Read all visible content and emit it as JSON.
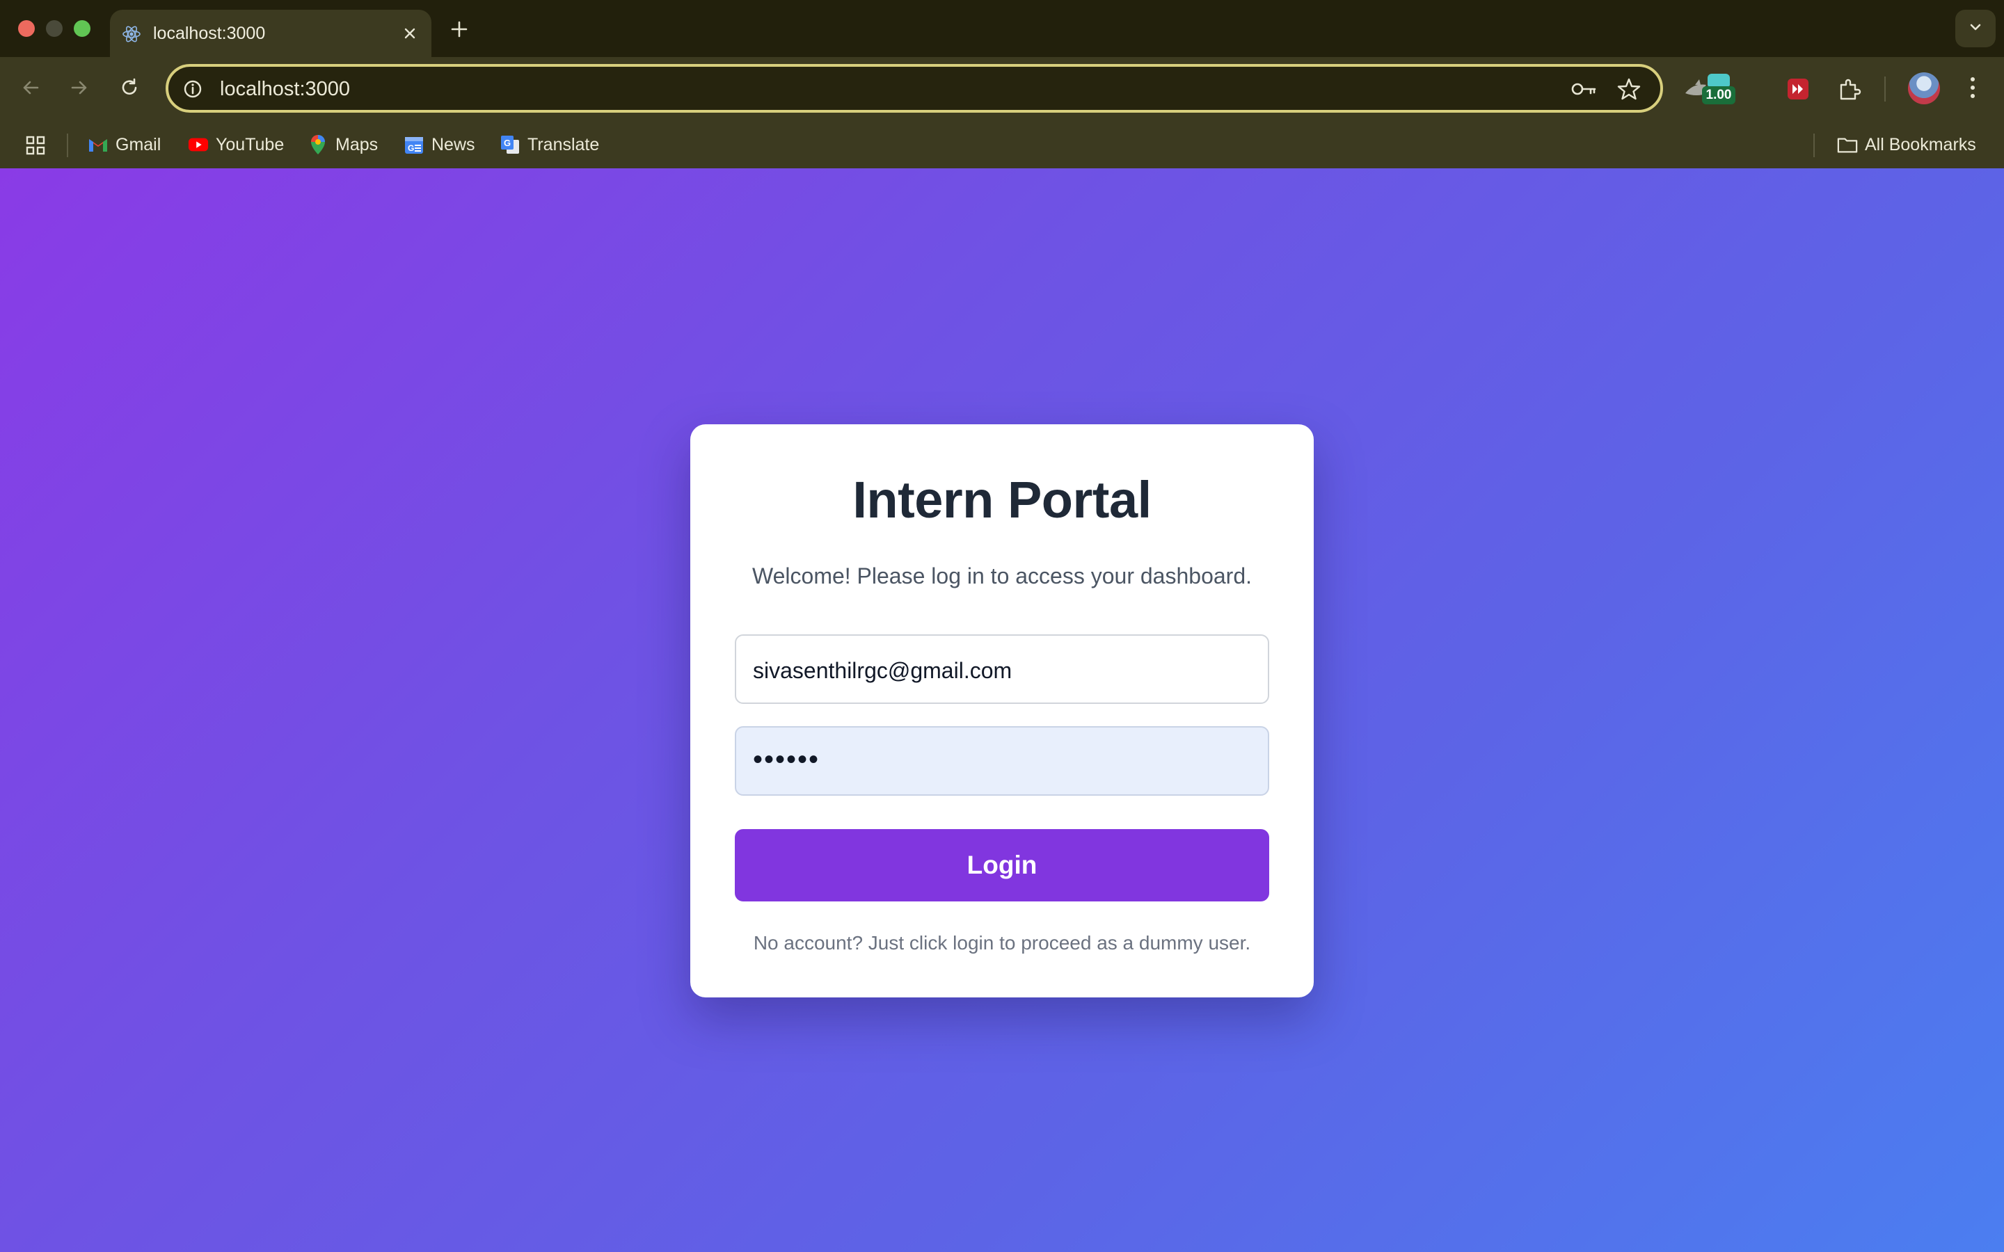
{
  "browser": {
    "tab": {
      "title": "localhost:3000"
    },
    "address_bar": {
      "url": "localhost:3000"
    },
    "extensions": {
      "badge_value": "1.00"
    },
    "bookmarks": [
      {
        "label": "Gmail",
        "icon": "gmail-icon"
      },
      {
        "label": "YouTube",
        "icon": "youtube-icon"
      },
      {
        "label": "Maps",
        "icon": "maps-icon"
      },
      {
        "label": "News",
        "icon": "news-icon"
      },
      {
        "label": "Translate",
        "icon": "translate-icon"
      }
    ],
    "all_bookmarks_label": "All Bookmarks"
  },
  "login": {
    "title": "Intern Portal",
    "welcome": "Welcome! Please log in to access your dashboard.",
    "email_value": "sivasenthilrgc@gmail.com",
    "password_mask": "••••••",
    "button_label": "Login",
    "hint": "No account? Just click login to proceed as a dummy user."
  },
  "colors": {
    "accent": "#8136df",
    "gradient_start": "#8a3be6",
    "gradient_end": "#4b7ef0",
    "autofill_bg": "#e8effc"
  }
}
